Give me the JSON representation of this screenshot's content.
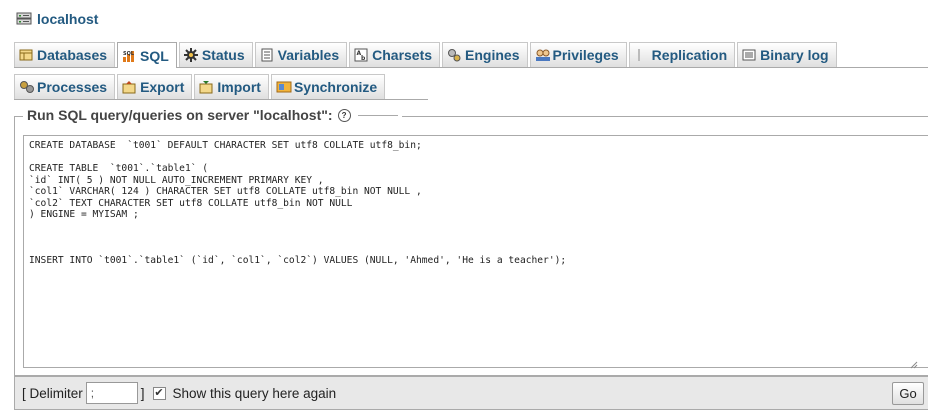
{
  "server": {
    "title": "localhost",
    "icon": "server-icon"
  },
  "tabs_row1": [
    {
      "label": "Databases",
      "icon": "databases-icon",
      "active": false
    },
    {
      "label": "SQL",
      "icon": "sql-icon",
      "active": true
    },
    {
      "label": "Status",
      "icon": "status-icon",
      "active": false
    },
    {
      "label": "Variables",
      "icon": "variables-icon",
      "active": false
    },
    {
      "label": "Charsets",
      "icon": "charsets-icon",
      "active": false
    },
    {
      "label": "Engines",
      "icon": "engines-icon",
      "active": false
    },
    {
      "label": "Privileges",
      "icon": "privileges-icon",
      "active": false
    },
    {
      "label": "Replication",
      "icon": "replication-icon",
      "active": false
    },
    {
      "label": "Binary log",
      "icon": "binary-log-icon",
      "active": false
    }
  ],
  "tabs_row2": [
    {
      "label": "Processes",
      "icon": "processes-icon",
      "active": false
    },
    {
      "label": "Export",
      "icon": "export-icon",
      "active": false
    },
    {
      "label": "Import",
      "icon": "import-icon",
      "active": false
    },
    {
      "label": "Synchronize",
      "icon": "synchronize-icon",
      "active": false
    }
  ],
  "query_panel": {
    "legend": "Run SQL query/queries on server \"localhost\":",
    "help_icon": "help-icon",
    "sql_text": "CREATE DATABASE  `t001` DEFAULT CHARACTER SET utf8 COLLATE utf8_bin;\n\nCREATE TABLE  `t001`.`table1` (\n`id` INT( 5 ) NOT NULL AUTO_INCREMENT PRIMARY KEY ,\n`col1` VARCHAR( 124 ) CHARACTER SET utf8 COLLATE utf8_bin NOT NULL ,\n`col2` TEXT CHARACTER SET utf8 COLLATE utf8_bin NOT NULL\n) ENGINE = MYISAM ;\n\n\n\nINSERT INTO `t001`.`table1` (`id`, `col1`, `col2`) VALUES (NULL, 'Ahmed', 'He is a teacher');"
  },
  "bottom_bar": {
    "delimiter_prefix": "[ Delimiter",
    "delimiter_value": ";",
    "delimiter_suffix": "]",
    "show_again_label": "Show this query here again",
    "show_again_checked": true,
    "go_label": "Go"
  },
  "colors": {
    "link": "#235a81",
    "border": "#aaaaaa",
    "bar_bg": "#e8e8e8"
  }
}
